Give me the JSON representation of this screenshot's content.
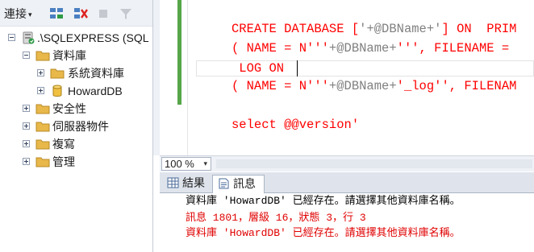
{
  "object_explorer": {
    "toolbar": {
      "connect_label": "連接",
      "icons": [
        "connect-icon",
        "disconnect-icon",
        "stop-icon",
        "filter-icon"
      ]
    },
    "tree": [
      {
        "label": ".\\SQLEXPRESS (SQL",
        "icon": "server-icon",
        "expanded": true,
        "level": 0
      },
      {
        "label": "資料庫",
        "icon": "folder-icon",
        "expanded": true,
        "level": 1
      },
      {
        "label": "系統資料庫",
        "icon": "folder-icon",
        "expanded": false,
        "level": 2
      },
      {
        "label": "HowardDB",
        "icon": "database-icon",
        "expanded": false,
        "level": 2
      },
      {
        "label": "安全性",
        "icon": "folder-icon",
        "expanded": false,
        "level": 1
      },
      {
        "label": "伺服器物件",
        "icon": "folder-icon",
        "expanded": false,
        "level": 1
      },
      {
        "label": "複寫",
        "icon": "folder-icon",
        "expanded": false,
        "level": 1
      },
      {
        "label": "管理",
        "icon": "folder-icon",
        "expanded": false,
        "level": 1
      }
    ]
  },
  "editor": {
    "lines": [
      {
        "segments": [
          {
            "text": "CREATE DATABASE [",
            "cls": "str"
          },
          {
            "text": "'+@DBName+'",
            "cls": "str"
          },
          {
            "text": "] ON  PRIM",
            "cls": "str"
          }
        ]
      },
      {
        "segments": [
          {
            "text": "( NAME = N'''",
            "cls": "str"
          },
          {
            "text": "+@DBName+",
            "cls": "str"
          },
          {
            "text": "''', FILENAME = ",
            "cls": "str"
          }
        ]
      },
      {
        "segments": [
          {
            "text": " LOG ON",
            "cls": "str"
          }
        ]
      },
      {
        "segments": [
          {
            "text": "( NAME = N'''",
            "cls": "str"
          },
          {
            "text": "+@DBName+",
            "cls": "str"
          },
          {
            "text": "'_log'', FILENAM",
            "cls": "str"
          }
        ]
      },
      {
        "segments": [
          {
            "text": "",
            "cls": "str"
          }
        ]
      },
      {
        "segments": [
          {
            "text": "select @@version'",
            "cls": "str"
          }
        ]
      }
    ]
  },
  "status": {
    "zoom_label": "100 %"
  },
  "results": {
    "tabs": [
      {
        "label": "結果",
        "icon": "grid-icon",
        "active": false
      },
      {
        "label": "訊息",
        "icon": "messages-icon",
        "active": true
      }
    ],
    "messages": [
      {
        "text": "資料庫 'HowardDB' 已經存在。請選擇其他資料庫名稱。",
        "error": false
      },
      {
        "text": "訊息 1801，層級 16，狀態 3，行 3",
        "error": true
      },
      {
        "text": "資料庫 'HowardDB' 已經存在。請選擇其他資料庫名稱。",
        "error": true
      }
    ]
  },
  "colors": {
    "string": "#ff0000",
    "error": "#e00000",
    "change_bar": "#57a64a",
    "folder": "#e8b84a"
  }
}
